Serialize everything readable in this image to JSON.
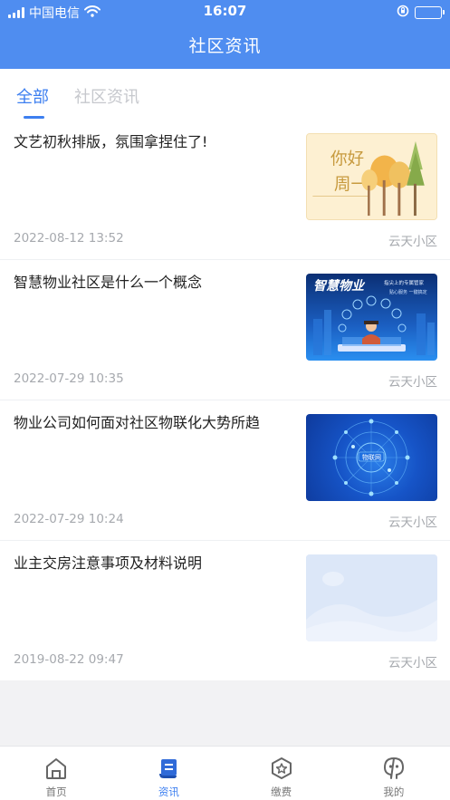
{
  "status_bar": {
    "carrier": "中国电信",
    "time": "16:07",
    "battery_color": "#4cd964"
  },
  "header": {
    "title": "社区资讯",
    "background": "#4f8df0"
  },
  "tabs": [
    {
      "label": "全部",
      "active": true
    },
    {
      "label": "社区资讯",
      "active": false
    }
  ],
  "news": [
    {
      "title": "文艺初秋排版，氛围拿捏住了!",
      "date": "2022-08-12 13:52",
      "source": "云天小区",
      "thumb_text_1": "你好",
      "thumb_text_2": "周一"
    },
    {
      "title": "智慧物业社区是什么一个概念",
      "date": "2022-07-29 10:35",
      "source": "云天小区",
      "thumb_text_1": "智慧物业",
      "thumb_text_2": "指尖上的专属管家",
      "thumb_text_3": "贴心服务 一键搞定"
    },
    {
      "title": "物业公司如何面对社区物联化大势所趋",
      "date": "2022-07-29 10:24",
      "source": "云天小区",
      "thumb_text_1": "物联网"
    },
    {
      "title": "业主交房注意事项及材料说明",
      "date": "2019-08-22 09:47",
      "source": "云天小区"
    }
  ],
  "bottom_nav": [
    {
      "label": "首页",
      "icon": "home-icon",
      "active": false
    },
    {
      "label": "资讯",
      "icon": "news-icon",
      "active": true
    },
    {
      "label": "缴费",
      "icon": "payment-icon",
      "active": false
    },
    {
      "label": "我的",
      "icon": "profile-icon",
      "active": false
    }
  ],
  "colors": {
    "accent": "#3d7ff0",
    "muted": "#a6a9ae"
  }
}
